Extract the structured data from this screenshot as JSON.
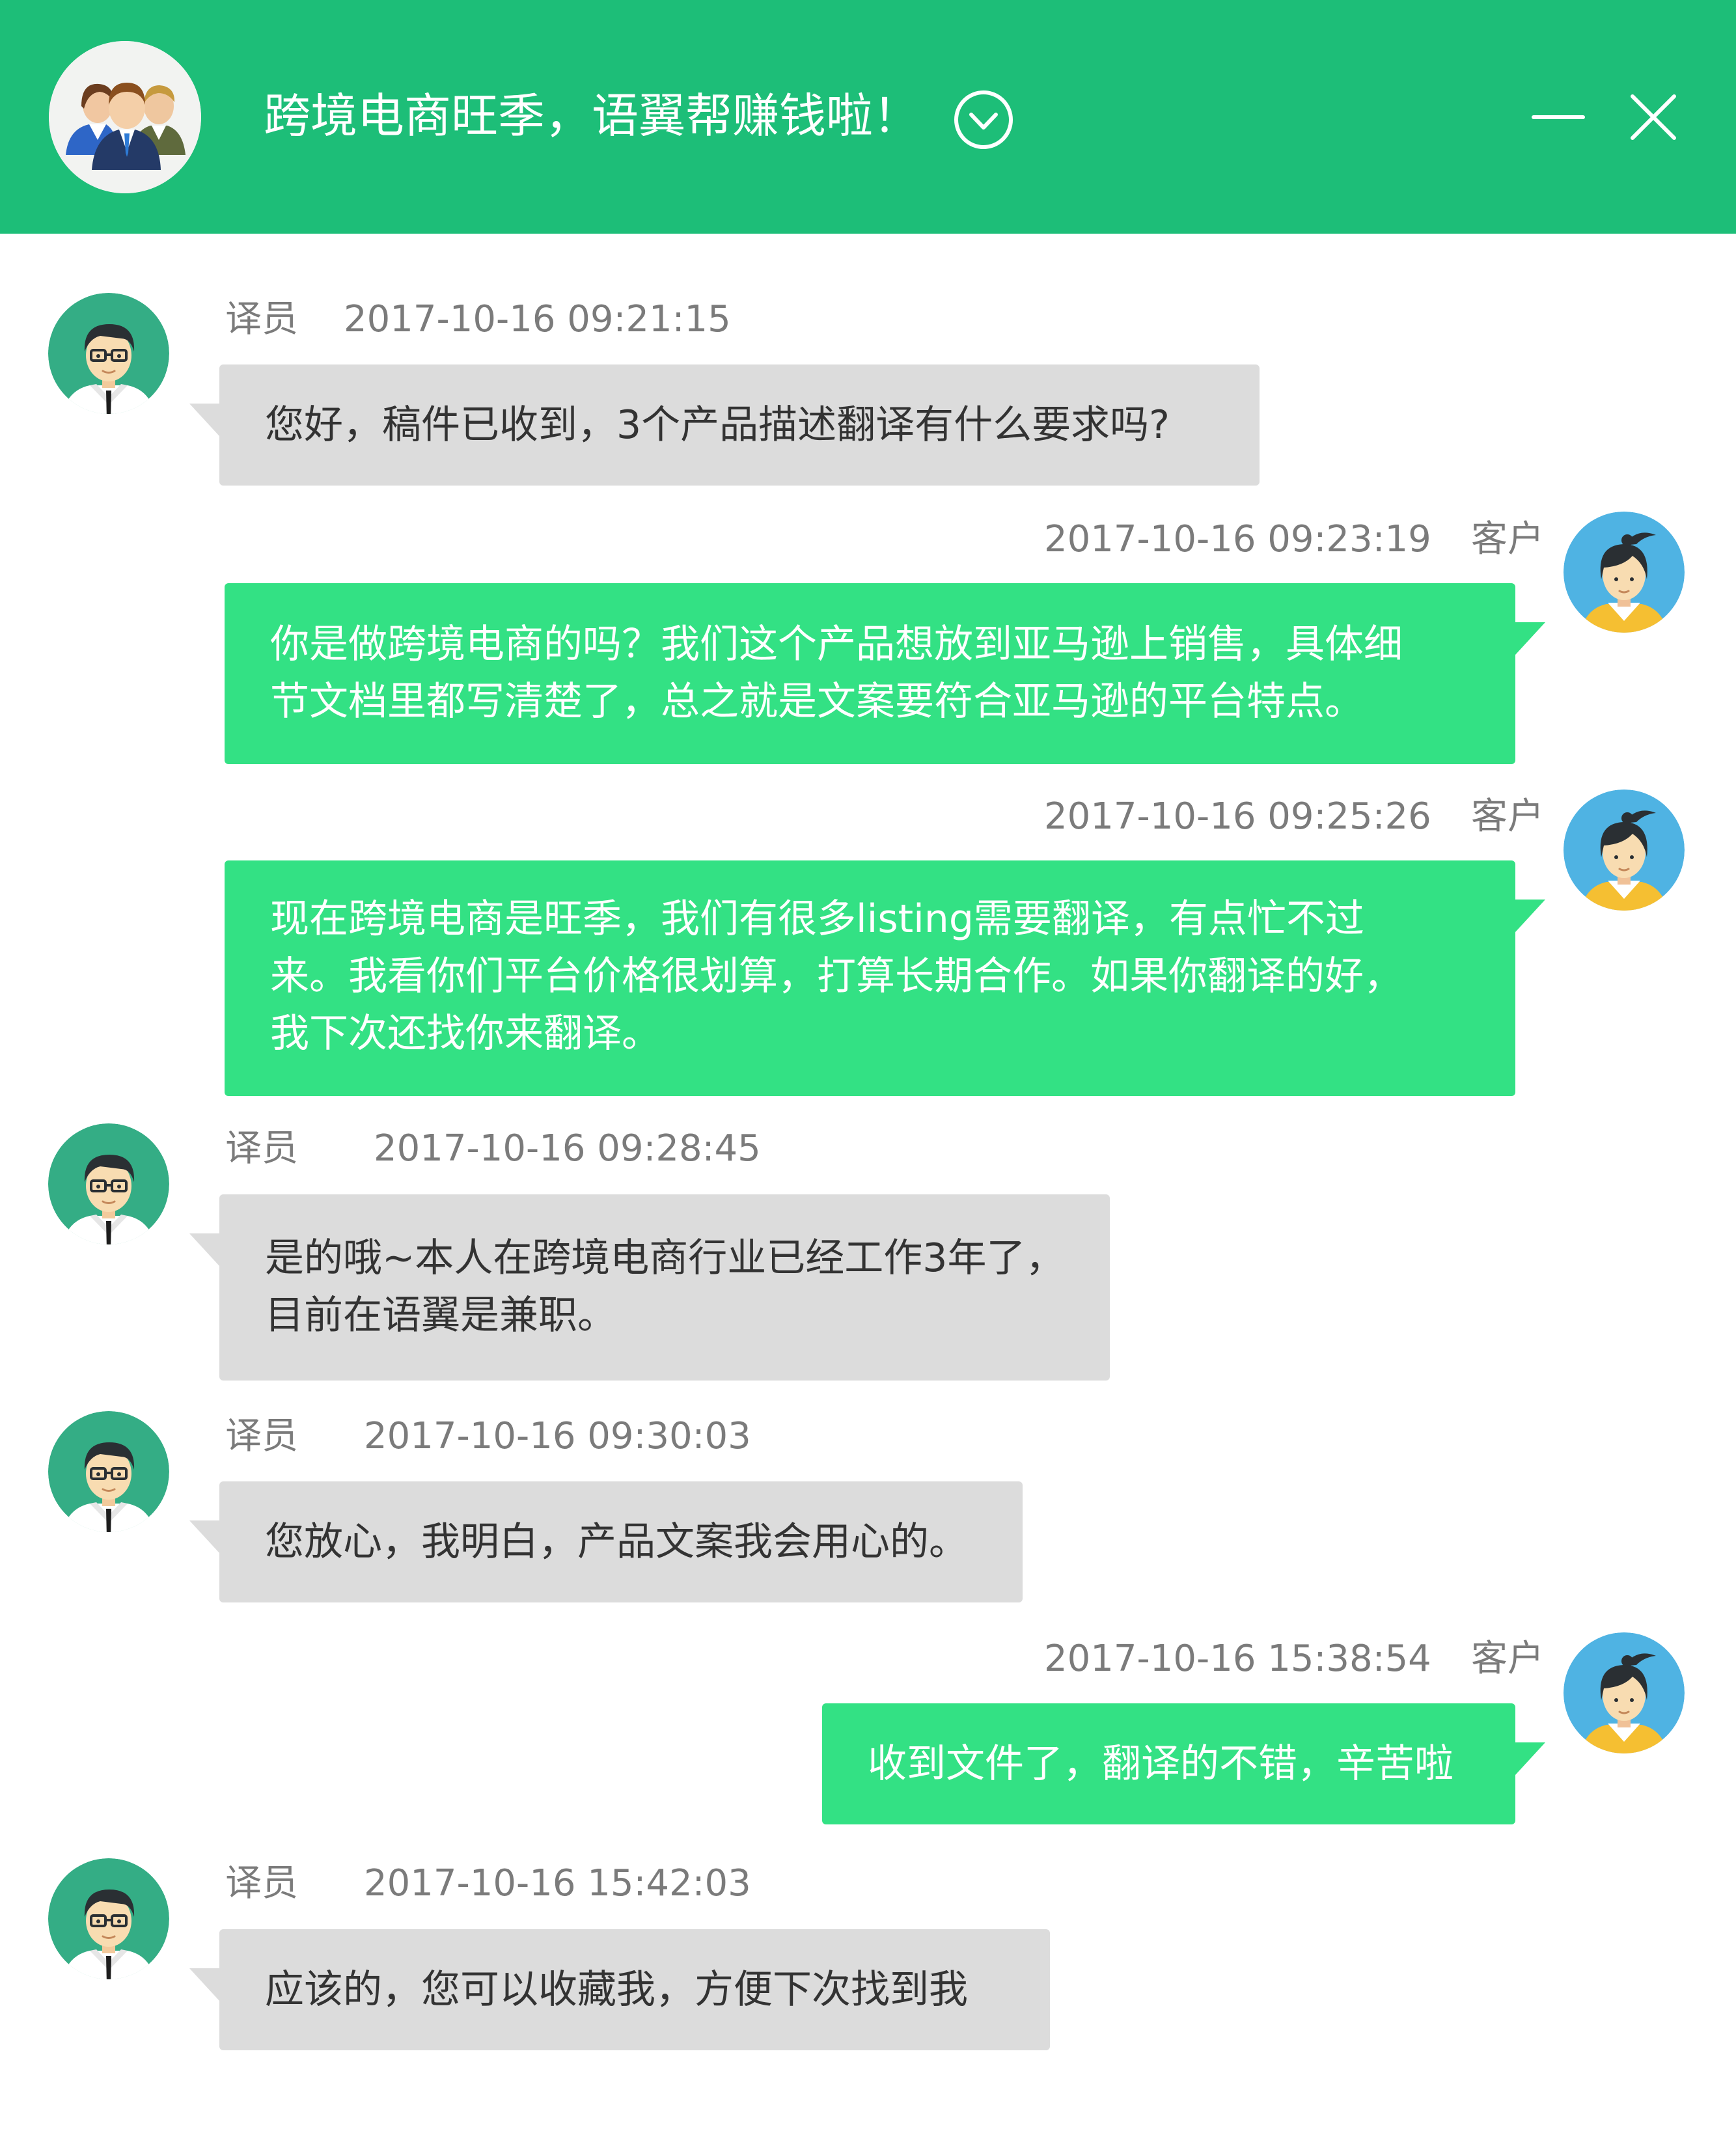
{
  "header": {
    "title": "跨境电商旺季，语翼帮赚钱啦！",
    "group_avatar_icon": "group-users-icon",
    "check_icon": "check-circle-icon",
    "minimize_icon": "minimize-icon",
    "close_icon": "close-icon",
    "background_color": "#1dbe78"
  },
  "colors": {
    "translator_bubble": "#dcdcdc",
    "customer_bubble": "#33e184",
    "meta_text": "#7b7b7b"
  },
  "messages": [
    {
      "sender": "译员",
      "time": "2017-10-16 09:21:15",
      "side": "left",
      "lines": [
        "您好，稿件已收到，3个产品描述翻译有什么要求吗?"
      ]
    },
    {
      "sender": "客户",
      "time": "2017-10-16 09:23:19",
      "side": "right",
      "lines": [
        "你是做跨境电商的吗？我们这个产品想放到亚马逊上销售，具体细",
        "节文档里都写清楚了，总之就是文案要符合亚马逊的平台特点。"
      ]
    },
    {
      "sender": "客户",
      "time": "2017-10-16 09:25:26",
      "side": "right",
      "lines": [
        "现在跨境电商是旺季，我们有很多listing需要翻译，有点忙不过",
        "来。我看你们平台价格很划算，打算长期合作。如果你翻译的好，",
        "我下次还找你来翻译。"
      ]
    },
    {
      "sender": "译员",
      "time": "2017-10-16 09:28:45",
      "side": "left",
      "lines": [
        "是的哦~本人在跨境电商行业已经工作3年了，",
        "目前在语翼是兼职。"
      ]
    },
    {
      "sender": "译员",
      "time": "2017-10-16 09:30:03",
      "side": "left",
      "lines": [
        "您放心，我明白，产品文案我会用心的。"
      ]
    },
    {
      "sender": "客户",
      "time": "2017-10-16 15:38:54",
      "side": "right",
      "lines": [
        "收到文件了，翻译的不错，辛苦啦"
      ]
    },
    {
      "sender": "译员",
      "time": "2017-10-16 15:42:03",
      "side": "left",
      "lines": [
        "应该的，您可以收藏我，方便下次找到我"
      ]
    }
  ]
}
